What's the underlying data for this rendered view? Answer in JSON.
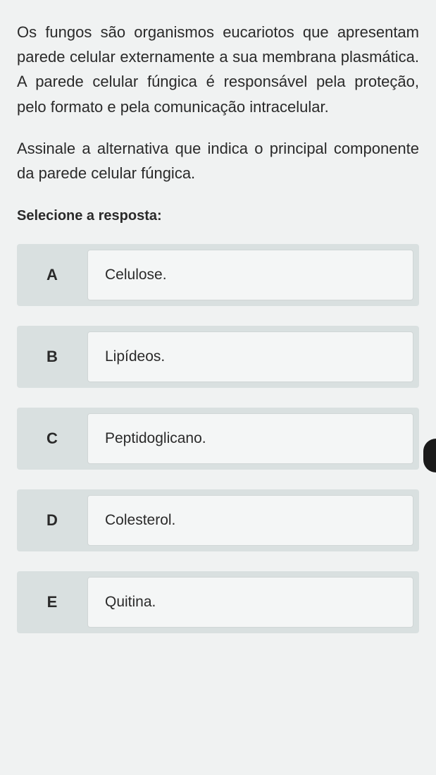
{
  "question": {
    "context": "Os fungos são organismos eucariotos que apresentam parede celular externamente a sua membrana plasmática. A parede celular fúngica é responsável pela proteção, pelo formato e pela comunicação intracelular.",
    "prompt": "Assinale a alternativa que indica o principal componente da parede celular fúngica.",
    "select_label": "Selecione a resposta:"
  },
  "options": [
    {
      "letter": "A",
      "text": "Celulose."
    },
    {
      "letter": "B",
      "text": "Lipídeos."
    },
    {
      "letter": "C",
      "text": "Peptidoglicano."
    },
    {
      "letter": "D",
      "text": "Colesterol."
    },
    {
      "letter": "E",
      "text": "Quitina."
    }
  ]
}
